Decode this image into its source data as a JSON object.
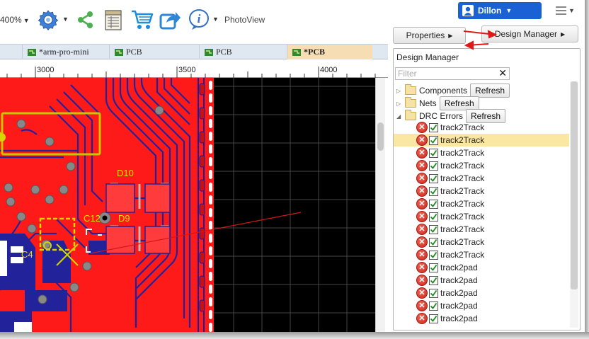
{
  "toolbar": {
    "zoom_label": "400%",
    "photoview_label": "PhotoView",
    "icons": [
      "gear-icon",
      "share-icon",
      "bom-icon",
      "cart-icon",
      "export-icon",
      "info-icon"
    ]
  },
  "header": {
    "user_name": "Dillon",
    "properties_label": "Properties",
    "design_manager_label": "Design Manager"
  },
  "doc_tabs": [
    {
      "label": "*arm-pro-mini",
      "active": false
    },
    {
      "label": "PCB",
      "active": false
    },
    {
      "label": "PCB",
      "active": false
    },
    {
      "label": "*PCB",
      "active": true
    }
  ],
  "ruler": {
    "labels": [
      "3000",
      "3500",
      "4000"
    ]
  },
  "canvas": {
    "labels": [
      "D10",
      "D9",
      "C12",
      "C4"
    ]
  },
  "design_manager": {
    "title": "Design Manager",
    "filter_placeholder": "Filter",
    "folders": [
      {
        "label": "Components",
        "refresh": "Refresh"
      },
      {
        "label": "Nets",
        "refresh": "Refresh"
      },
      {
        "label": "DRC Errors",
        "refresh": "Refresh"
      }
    ],
    "errors": [
      {
        "label": "track2Track",
        "selected": false
      },
      {
        "label": "track2Track",
        "selected": true
      },
      {
        "label": "track2Track",
        "selected": false
      },
      {
        "label": "track2Track",
        "selected": false
      },
      {
        "label": "track2Track",
        "selected": false
      },
      {
        "label": "track2Track",
        "selected": false
      },
      {
        "label": "track2Track",
        "selected": false
      },
      {
        "label": "track2Track",
        "selected": false
      },
      {
        "label": "track2Track",
        "selected": false
      },
      {
        "label": "track2Track",
        "selected": false
      },
      {
        "label": "track2Track",
        "selected": false
      },
      {
        "label": "track2pad",
        "selected": false
      },
      {
        "label": "track2pad",
        "selected": false
      },
      {
        "label": "track2pad",
        "selected": false
      },
      {
        "label": "track2pad",
        "selected": false
      },
      {
        "label": "track2pad",
        "selected": false
      }
    ]
  },
  "colors": {
    "accent": "#1a61d6",
    "board_copper": "#ff1a1a",
    "silkscreen": "#c8c800",
    "selected_row": "#fbe7a1",
    "error_icon": "#d42a1e"
  }
}
